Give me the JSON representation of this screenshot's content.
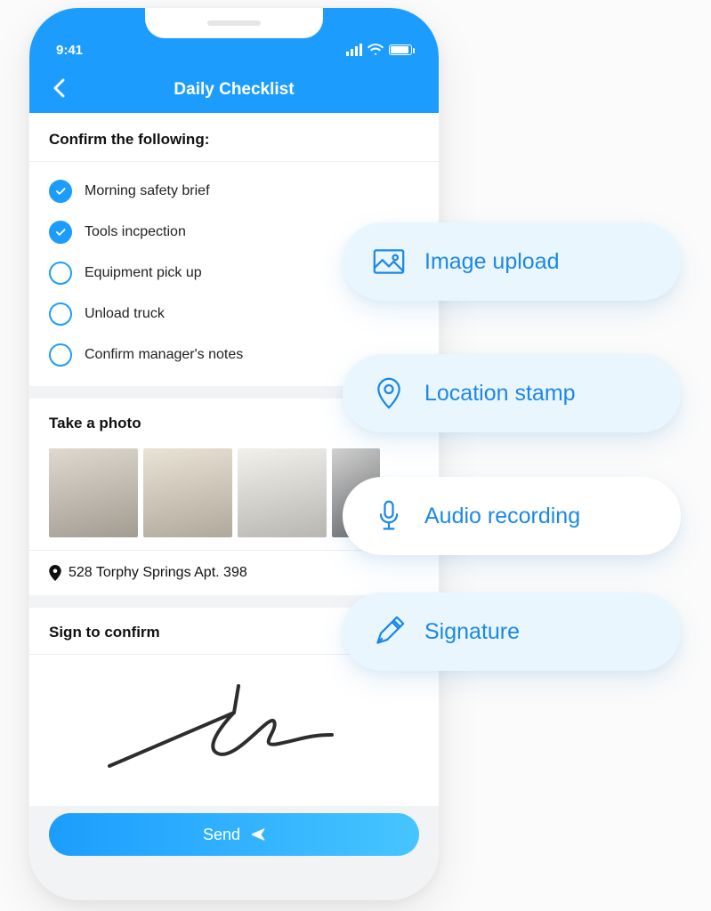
{
  "status": {
    "time": "9:41"
  },
  "nav": {
    "title": "Daily Checklist"
  },
  "confirm": {
    "heading": "Confirm the following:",
    "items": [
      {
        "label": "Morning safety brief",
        "checked": true
      },
      {
        "label": "Tools incpection",
        "checked": true
      },
      {
        "label": "Equipment pick up",
        "checked": false
      },
      {
        "label": "Unload truck",
        "checked": false
      },
      {
        "label": "Confirm manager's notes",
        "checked": false
      }
    ]
  },
  "photo": {
    "heading": "Take a photo"
  },
  "location": {
    "address": "528 Torphy Springs Apt. 398"
  },
  "signature": {
    "heading": "Sign to confirm"
  },
  "actions": {
    "send": "Send"
  },
  "features": {
    "image_upload": "Image upload",
    "location_stamp": "Location stamp",
    "audio_recording": "Audio recording",
    "signature": "Signature"
  },
  "colors": {
    "brand": "#1C9DFD",
    "pill_bg": "#EAF6FE",
    "pill_text": "#1C88E5"
  }
}
